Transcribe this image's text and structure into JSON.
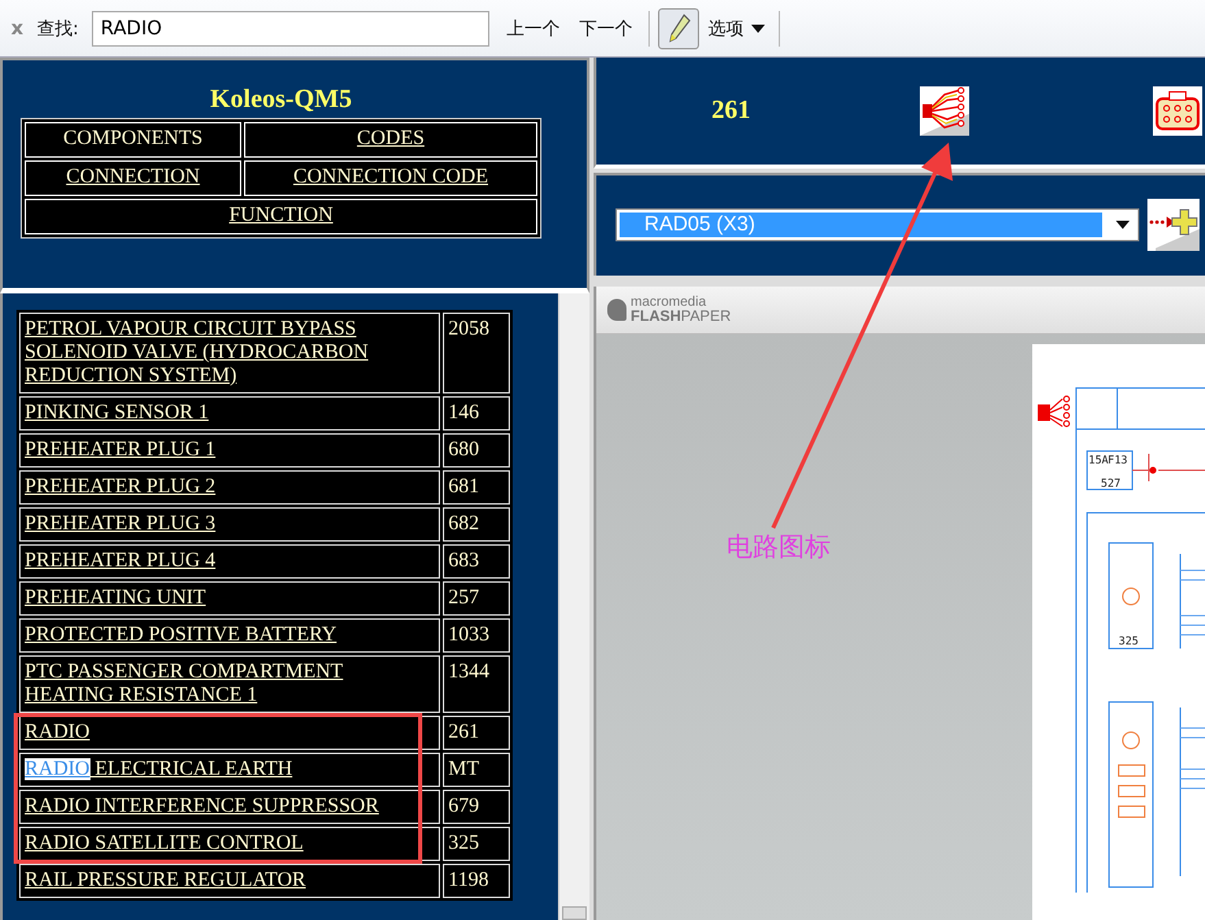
{
  "find_bar": {
    "close": "x",
    "label": "查找:",
    "value": "RADIO",
    "prev": "上一个",
    "next": "下一个",
    "options": "选项"
  },
  "header": {
    "title": "Koleos-QM5",
    "nav": [
      {
        "label": "COMPONENTS",
        "underlined": false,
        "wide": false
      },
      {
        "label": "CODES",
        "underlined": true,
        "wide": false
      },
      {
        "label": "CONNECTION",
        "underlined": true,
        "wide": false
      },
      {
        "label": "CONNECTION CODE",
        "underlined": true,
        "wide": false
      },
      {
        "label": "FUNCTION",
        "underlined": true,
        "wide": true
      }
    ]
  },
  "components": [
    {
      "name": [
        {
          "text": "PETROL VAPOUR CIRCUIT BYPASS SOLENOID VALVE (HYDROCARBON REDUCTION SYSTEM)",
          "highlighted": false
        }
      ],
      "code": "2058"
    },
    {
      "name": [
        {
          "text": "PINKING SENSOR 1",
          "highlighted": false
        }
      ],
      "code": "146"
    },
    {
      "name": [
        {
          "text": "PREHEATER PLUG 1",
          "highlighted": false
        }
      ],
      "code": "680"
    },
    {
      "name": [
        {
          "text": "PREHEATER PLUG 2",
          "highlighted": false
        }
      ],
      "code": "681"
    },
    {
      "name": [
        {
          "text": "PREHEATER PLUG 3",
          "highlighted": false
        }
      ],
      "code": "682"
    },
    {
      "name": [
        {
          "text": "PREHEATER PLUG 4",
          "highlighted": false
        }
      ],
      "code": "683"
    },
    {
      "name": [
        {
          "text": "PREHEATING UNIT",
          "highlighted": false
        }
      ],
      "code": "257"
    },
    {
      "name": [
        {
          "text": "PROTECTED POSITIVE BATTERY",
          "highlighted": false
        }
      ],
      "code": "1033"
    },
    {
      "name": [
        {
          "text": "PTC PASSENGER COMPARTMENT HEATING RESISTANCE 1",
          "highlighted": false
        }
      ],
      "code": "1344"
    },
    {
      "name": [
        {
          "text": "RADIO",
          "highlighted": false
        }
      ],
      "code": "261",
      "framed": true
    },
    {
      "name": [
        {
          "text": "RADIO",
          "highlighted": true
        },
        {
          "text": " ELECTRICAL EARTH",
          "highlighted": false
        }
      ],
      "code": "MT",
      "framed": true
    },
    {
      "name": [
        {
          "text": "RADIO INTERFERENCE SUPPRESSOR",
          "highlighted": false
        }
      ],
      "code": "679",
      "framed": true
    },
    {
      "name": [
        {
          "text": "RADIO SATELLITE CONTROL",
          "highlighted": false
        }
      ],
      "code": "325",
      "framed": true
    },
    {
      "name": [
        {
          "text": "RAIL PRESSURE REGULATOR",
          "highlighted": false
        }
      ],
      "code": "1198"
    }
  ],
  "detail": {
    "code": "261",
    "connector": {
      "value": "RAD05 (X3)",
      "selected": true
    }
  },
  "viewer": {
    "logo_top": "macromedia",
    "logo_bold": "FLASH",
    "logo_rest": "PAPER",
    "diagram": {
      "fuse": "15A",
      "fuse_id": "F13",
      "supply": "527",
      "module": "325"
    }
  },
  "annotation": {
    "label": "电路图标"
  }
}
